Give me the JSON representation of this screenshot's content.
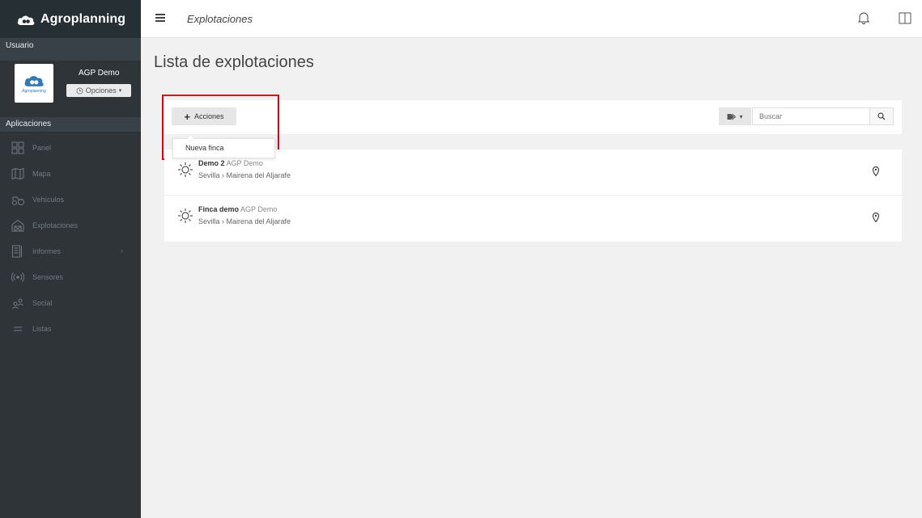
{
  "brand": {
    "name": "Agroplanning",
    "avatar_text": "Agroplanning"
  },
  "user": {
    "section_label": "Usuario",
    "name": "AGP Demo",
    "options_label": "Opciones"
  },
  "sidebar": {
    "apps_label": "Aplicaciones",
    "items": [
      {
        "label": "Panel",
        "icon": "grid-icon"
      },
      {
        "label": "Mapa",
        "icon": "map-icon"
      },
      {
        "label": "Vehículos",
        "icon": "vehicle-icon"
      },
      {
        "label": "Explotaciones",
        "icon": "barn-icon"
      },
      {
        "label": "Informes",
        "icon": "report-icon"
      },
      {
        "label": "Sensores",
        "icon": "sensor-icon"
      },
      {
        "label": "Social",
        "icon": "social-icon"
      },
      {
        "label": "Listas",
        "icon": "list-icon"
      }
    ]
  },
  "header": {
    "breadcrumb": "Explotaciones"
  },
  "main": {
    "title": "Lista de explotaciones",
    "actions_label": "Acciones",
    "dropdown_item": "Nueva finca",
    "search_placeholder": "Buscar",
    "farms": [
      {
        "name": "Demo 2",
        "owner": "AGP Demo",
        "location": "Sevilla › Mairena del Aljarafe"
      },
      {
        "name": "Finca demo",
        "owner": "AGP Demo",
        "location": "Sevilla › Mairena del Aljarafe"
      }
    ]
  },
  "colors": {
    "sidebar": "#2e3438",
    "highlight": "#e3000f",
    "brand_blue": "#2f7ab6"
  }
}
